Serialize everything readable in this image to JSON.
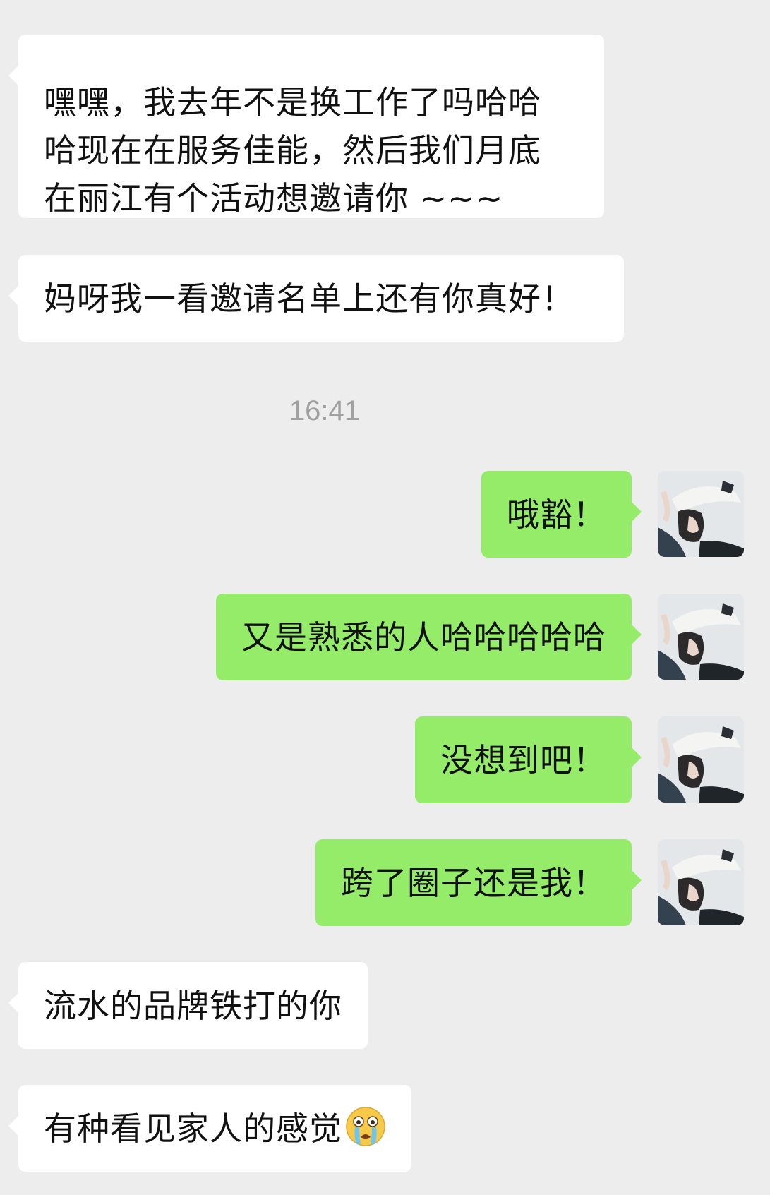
{
  "timestamp": "16:41",
  "messages": [
    {
      "side": "in",
      "lines": [
        "嘿嘿，我去年不是换工作了吗哈哈",
        "哈现在在服务佳能，然后我们月底",
        "在丽江有个活动想邀请你 ~~~"
      ]
    },
    {
      "side": "in",
      "lines": [
        "妈呀我一看邀请名单上还有你真好！"
      ]
    },
    {
      "side": "out",
      "lines": [
        "哦豁！"
      ]
    },
    {
      "side": "out",
      "lines": [
        "又是熟悉的人哈哈哈哈哈"
      ]
    },
    {
      "side": "out",
      "lines": [
        "没想到吧！"
      ]
    },
    {
      "side": "out",
      "lines": [
        "跨了圈子还是我！"
      ]
    },
    {
      "side": "in",
      "lines": [
        "流水的品牌铁打的你"
      ]
    },
    {
      "side": "in",
      "lines": [
        "有种看见家人的感觉"
      ],
      "emoji": "loudly-crying-face-icon"
    }
  ],
  "colors": {
    "background": "#ededed",
    "incoming_bubble": "#ffffff",
    "outgoing_bubble": "#95ec69",
    "timestamp_text": "#a0a0a0"
  }
}
